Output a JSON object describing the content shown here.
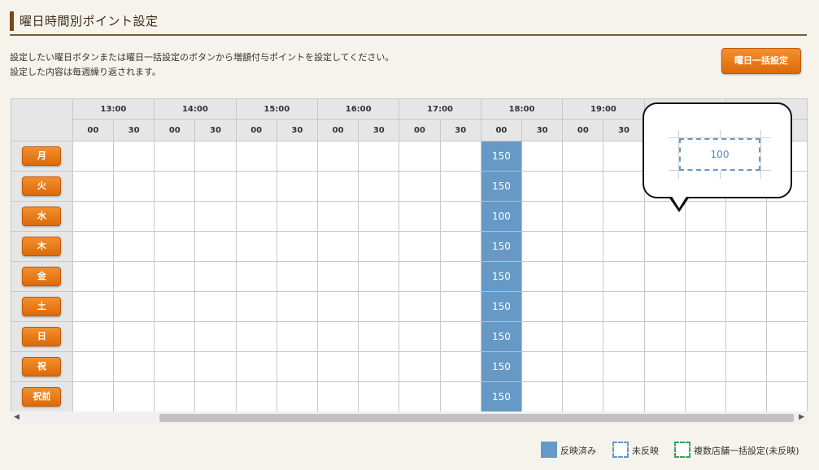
{
  "title": "曜日時間別ポイント設定",
  "description": [
    "設定したい曜日ボタンまたは曜日一括設定のボタンから増額付与ポイントを設定してください。",
    "設定した内容は毎週繰り返されます。"
  ],
  "bulk_button": "曜日一括設定",
  "grid": {
    "hours": [
      "13:00",
      "14:00",
      "15:00",
      "16:00",
      "17:00",
      "18:00",
      "19:00",
      "",
      ""
    ],
    "minutes": [
      "00",
      "30"
    ],
    "days": [
      {
        "label": "月",
        "value": "150"
      },
      {
        "label": "火",
        "value": "150"
      },
      {
        "label": "水",
        "value": "100"
      },
      {
        "label": "木",
        "value": "150"
      },
      {
        "label": "金",
        "value": "150"
      },
      {
        "label": "土",
        "value": "150"
      },
      {
        "label": "日",
        "value": "150"
      },
      {
        "label": "祝",
        "value": "150"
      },
      {
        "label": "祝前",
        "value": "150"
      }
    ],
    "active_slot_index": 10
  },
  "popup": {
    "value": "100"
  },
  "legend": {
    "applied": "反映済み",
    "not_applied": "未反映",
    "multi_store": "複数店舗一括設定(未反映)"
  },
  "colors": {
    "applied": "#6699c5",
    "accent": "#e9790f",
    "multi_store": "#3aa35f"
  }
}
